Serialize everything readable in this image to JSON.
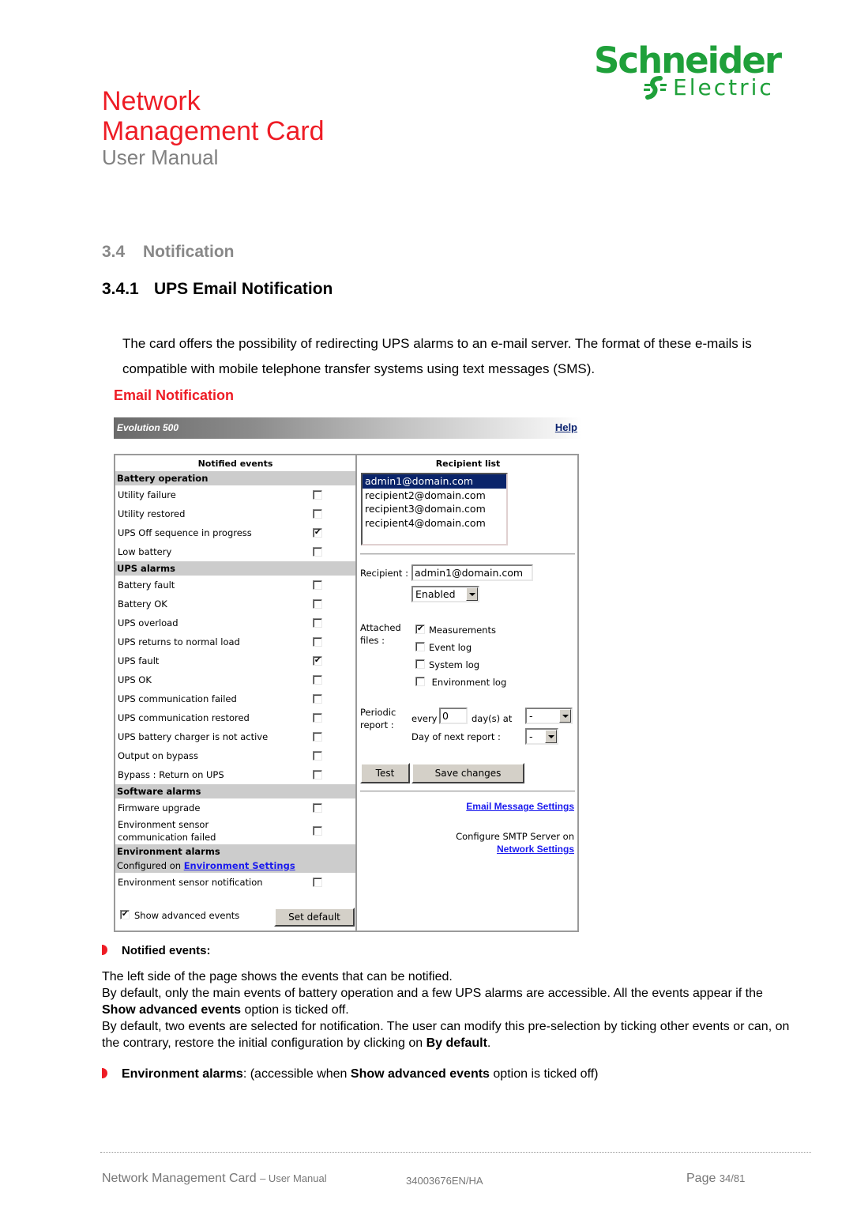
{
  "brand": {
    "logo_line1": "Schneider",
    "logo_line2": "Electric",
    "color": "#1fa03a"
  },
  "header": {
    "title_line1": "Network",
    "title_line2": "Management Card",
    "subtitle": "User Manual",
    "title_color": "#ee1c25"
  },
  "section": {
    "number": "3.4",
    "title": "Notification",
    "subsection_number": "3.4.1",
    "subsection_title": "UPS Email Notification",
    "intro": "The card offers the possibility of redirecting UPS alarms to an e-mail server. The format of these e-mails is compatible with mobile telephone transfer systems using text messages (SMS)."
  },
  "screenshot": {
    "page_title": "Email Notification",
    "device_name": "Evolution 500",
    "help_link": "Help",
    "left_pane": {
      "header": "Notified events",
      "groups": [
        {
          "name": "Battery operation",
          "events": [
            {
              "label": "Utility failure",
              "checked": false
            },
            {
              "label": "Utility restored",
              "checked": false
            },
            {
              "label": "UPS Off sequence in progress",
              "checked": true
            },
            {
              "label": "Low battery",
              "checked": false
            }
          ]
        },
        {
          "name": "UPS alarms",
          "events": [
            {
              "label": "Battery fault",
              "checked": false
            },
            {
              "label": "Battery OK",
              "checked": false
            },
            {
              "label": "UPS overload",
              "checked": false
            },
            {
              "label": "UPS returns to normal load",
              "checked": false
            },
            {
              "label": "UPS fault",
              "checked": true
            },
            {
              "label": "UPS OK",
              "checked": false
            },
            {
              "label": "UPS communication failed",
              "checked": false
            },
            {
              "label": "UPS communication restored",
              "checked": false
            },
            {
              "label": "UPS battery charger is not active",
              "checked": false
            },
            {
              "label": "Output on bypass",
              "checked": false
            },
            {
              "label": "Bypass : Return on UPS",
              "checked": false
            }
          ]
        },
        {
          "name": "Software alarms",
          "events": [
            {
              "label": "Firmware upgrade",
              "checked": false
            },
            {
              "label_line1": "Environment sensor",
              "label_line2": "communication failed",
              "checked": false
            }
          ]
        },
        {
          "name": "Environment alarms",
          "configured_prefix": "Configured on",
          "configured_link": "Environment Settings",
          "events": [
            {
              "label": "Environment sensor notification",
              "checked": false
            }
          ]
        }
      ],
      "show_advanced_label": "Show advanced events",
      "show_advanced_checked": true,
      "set_default_button": "Set default"
    },
    "right_pane": {
      "header": "Recipient list",
      "recipients": [
        "admin1@domain.com",
        "recipient2@domain.com",
        "recipient3@domain.com",
        "recipient4@domain.com"
      ],
      "selected_recipient_index": 0,
      "recipient_label": "Recipient :",
      "recipient_value": "admin1@domain.com",
      "status_value": "Enabled",
      "attached_label_line1": "Attached",
      "attached_label_line2": "files :",
      "attachments": [
        {
          "label": "Measurements",
          "checked": true
        },
        {
          "label": "Event log",
          "checked": false
        },
        {
          "label": "System log",
          "checked": false
        },
        {
          "label": "Environment log",
          "checked": false
        }
      ],
      "periodic_label_line1": "Periodic",
      "periodic_label_line2": "report :",
      "every_label": "every",
      "every_value": "0",
      "days_at_label": "day(s) at",
      "time_value": "-",
      "next_report_label": "Day of next report :",
      "next_report_value": "-",
      "test_button": "Test",
      "save_button": "Save changes",
      "email_settings_link": "Email Message Settings",
      "smtp_text": "Configure SMTP Server on",
      "network_settings_link": "Network Settings"
    }
  },
  "notes": {
    "bullet1_title": "Notified events:",
    "para1": "The left side of the page shows the events that can be notified.",
    "para2_a": "By default, only the main events of battery operation and a few UPS alarms are accessible. All the events appear if the ",
    "para2_bold": "Show advanced events",
    "para2_b": " option is ticked off.",
    "para3_a": "By default, two events are selected for notification. The user can modify this pre-selection by ticking other events or can, on the contrary, restore the initial configuration by clicking on ",
    "para3_bold": "By default",
    "para3_b": ".",
    "bullet2_title": "Environment alarms",
    "bullet2_a": ": (accessible when ",
    "bullet2_bold": "Show advanced events",
    "bullet2_b": " option is ticked off)"
  },
  "footer": {
    "doc_title": "Network Management Card",
    "doc_sub": "– User Manual",
    "doc_ref": "34003676EN/HA",
    "page_label": "Page",
    "page_value": "34/81"
  }
}
